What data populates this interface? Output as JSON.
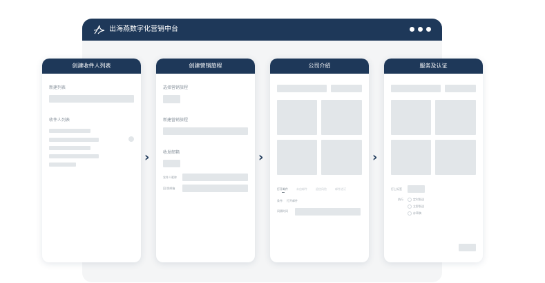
{
  "app": {
    "title": "出海燕数字化营销中台"
  },
  "cards": [
    {
      "title": "创建收件人列表",
      "new_list_label": "新建列表",
      "recipient_list_label": "收件人列表"
    },
    {
      "title": "创建营销旅程",
      "select_label": "选择营销旅程",
      "new_label": "新建营销旅程",
      "mailbox_label": "收发邮箱",
      "sender_name_label": "发件人昵称",
      "reply_label": "回/发邮箱"
    },
    {
      "title": "公司介绍",
      "tabs": [
        "打开邮件",
        "未启邮件",
        "退信风险",
        "邮件进订"
      ],
      "condition_label": "条件:",
      "condition_value": "打开邮件",
      "interval_label": "间隔时间"
    },
    {
      "title": "服务及认证",
      "label_tag": "打上标签",
      "exec_label": "执行",
      "options": [
        "定时发送",
        "立即发送",
        "存草稿"
      ]
    }
  ]
}
